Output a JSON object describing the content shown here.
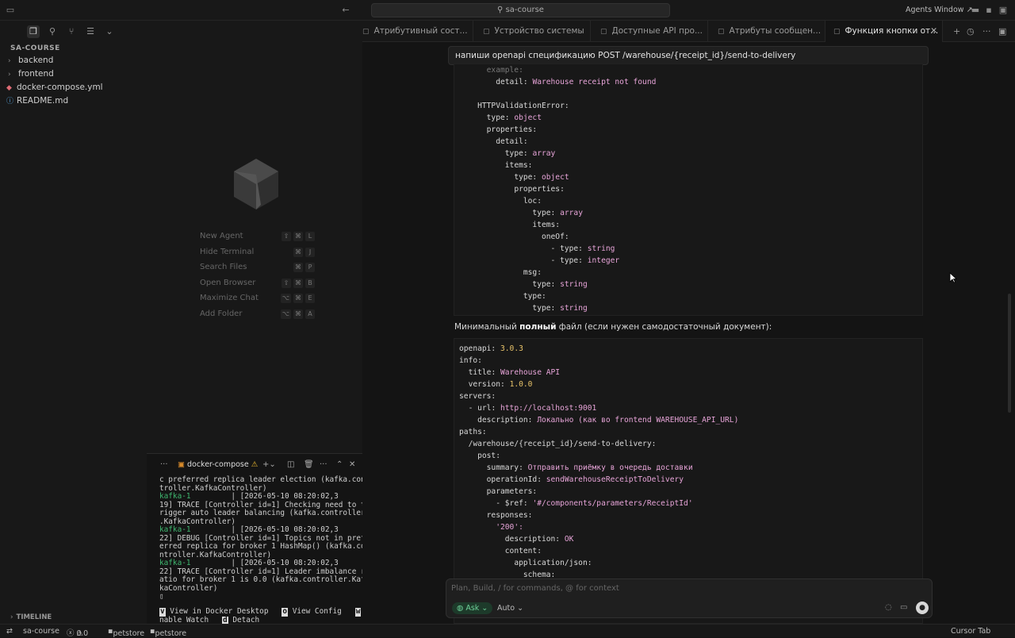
{
  "window": {
    "search_text": "sa-course",
    "agents_window": "Agents Window ↗"
  },
  "sidebar": {
    "project": "SA-COURSE",
    "items": [
      {
        "label": "backend",
        "kind": "folder"
      },
      {
        "label": "frontend",
        "kind": "folder"
      },
      {
        "label": "docker-compose.yml",
        "kind": "docker"
      },
      {
        "label": "README.md",
        "kind": "info"
      }
    ],
    "timeline": "TIMELINE"
  },
  "center": {
    "shortcuts": [
      {
        "label": "New Agent",
        "keys": [
          "⇧",
          "⌘",
          "L"
        ]
      },
      {
        "label": "Hide Terminal",
        "keys": [
          "⌘",
          "J"
        ]
      },
      {
        "label": "Search Files",
        "keys": [
          "⌘",
          "P"
        ]
      },
      {
        "label": "Open Browser",
        "keys": [
          "⇧",
          "⌘",
          "B"
        ]
      },
      {
        "label": "Maximize Chat",
        "keys": [
          "⌥",
          "⌘",
          "E"
        ]
      },
      {
        "label": "Add Folder",
        "keys": [
          "⌥",
          "⌘",
          "A"
        ]
      }
    ]
  },
  "terminal": {
    "tab_label": "docker-compose",
    "lines": [
      {
        "p": "",
        "t": "c preferred replica leader election (kafka.con"
      },
      {
        "p": "",
        "t": "troller.KafkaController)"
      },
      {
        "p": "kafka-1",
        "t": "         | [2026-05-10 08:20:02,3"
      },
      {
        "p": "",
        "t": "19] TRACE [Controller id=1] Checking need to t"
      },
      {
        "p": "",
        "t": "rigger auto leader balancing (kafka.controller"
      },
      {
        "p": "",
        "t": ".KafkaController)"
      },
      {
        "p": "kafka-1",
        "t": "         | [2026-05-10 08:20:02,3"
      },
      {
        "p": "",
        "t": "22] DEBUG [Controller id=1] Topics not in pref"
      },
      {
        "p": "",
        "t": "erred replica for broker 1 HashMap() (kafka.co"
      },
      {
        "p": "",
        "t": "ntroller.KafkaController)"
      },
      {
        "p": "kafka-1",
        "t": "         | [2026-05-10 08:20:02,3"
      },
      {
        "p": "",
        "t": "22] TRACE [Controller id=1] Leader imbalance r"
      },
      {
        "p": "",
        "t": "atio for broker 1 is 0.0 (kafka.controller.Kaf"
      },
      {
        "p": "",
        "t": "kaController)"
      },
      {
        "p": "",
        "t": "▯"
      }
    ],
    "footer": {
      "k1": "v",
      "a1": " View in Docker Desktop   ",
      "k2": "o",
      "a2": " View Config   ",
      "k3": "w",
      "a3": " E",
      "l2a": "nable Watch   ",
      "k4": "d",
      "a4": " Detach"
    }
  },
  "tabs": [
    {
      "label": "Атрибутивный сост..."
    },
    {
      "label": "Устройство системы"
    },
    {
      "label": "Доступные API про..."
    },
    {
      "label": "Атрибуты сообщен..."
    },
    {
      "label": "Функция кнопки от..."
    }
  ],
  "chat": {
    "prompt": "напиши openapi спецификацию POST /warehouse/{receipt_id}/send-to-delivery",
    "block1": [
      {
        "i": 3,
        "k": "example:",
        "v": "",
        "dim": true
      },
      {
        "i": 4,
        "k": "detail:",
        "v": "Warehouse receipt not found"
      },
      {
        "i": 0,
        "k": "",
        "v": ""
      },
      {
        "i": 2,
        "k": "HTTPValidationError:",
        "v": ""
      },
      {
        "i": 3,
        "k": "type:",
        "v": "object"
      },
      {
        "i": 3,
        "k": "properties:",
        "v": ""
      },
      {
        "i": 4,
        "k": "detail:",
        "v": ""
      },
      {
        "i": 5,
        "k": "type:",
        "v": "array"
      },
      {
        "i": 5,
        "k": "items:",
        "v": ""
      },
      {
        "i": 6,
        "k": "type:",
        "v": "object"
      },
      {
        "i": 6,
        "k": "properties:",
        "v": ""
      },
      {
        "i": 7,
        "k": "loc:",
        "v": ""
      },
      {
        "i": 8,
        "k": "type:",
        "v": "array"
      },
      {
        "i": 8,
        "k": "items:",
        "v": ""
      },
      {
        "i": 9,
        "k": "oneOf:",
        "v": ""
      },
      {
        "i": 10,
        "k": "- type:",
        "v": "string"
      },
      {
        "i": 10,
        "k": "- type:",
        "v": "integer"
      },
      {
        "i": 7,
        "k": "msg:",
        "v": ""
      },
      {
        "i": 8,
        "k": "type:",
        "v": "string"
      },
      {
        "i": 7,
        "k": "type:",
        "v": ""
      },
      {
        "i": 8,
        "k": "type:",
        "v": "string"
      }
    ],
    "mid_pre": "Минимальный ",
    "mid_bold": "полный",
    "mid_post": " файл (если нужен самодостаточный документ):",
    "block2": [
      {
        "i": 0,
        "k": "openapi:",
        "v": "3.0.3",
        "c": "n"
      },
      {
        "i": 0,
        "k": "info:",
        "v": ""
      },
      {
        "i": 1,
        "k": "title:",
        "v": "Warehouse API"
      },
      {
        "i": 1,
        "k": "version:",
        "v": "1.0.0",
        "c": "n"
      },
      {
        "i": 0,
        "k": "servers:",
        "v": ""
      },
      {
        "i": 1,
        "k": "- url:",
        "v": "http://localhost:9001"
      },
      {
        "i": 2,
        "k": "description:",
        "v": "Локально (как во frontend WAREHOUSE_API_URL)"
      },
      {
        "i": 0,
        "k": "paths:",
        "v": ""
      },
      {
        "i": 1,
        "k": "/warehouse/{receipt_id}/send-to-delivery:",
        "v": ""
      },
      {
        "i": 2,
        "k": "post:",
        "v": ""
      },
      {
        "i": 3,
        "k": "summary:",
        "v": "Отправить приёмку в очередь доставки"
      },
      {
        "i": 3,
        "k": "operationId:",
        "v": "sendWarehouseReceiptToDelivery"
      },
      {
        "i": 3,
        "k": "parameters:",
        "v": ""
      },
      {
        "i": 4,
        "k": "- $ref:",
        "v": "'#/components/parameters/ReceiptId'"
      },
      {
        "i": 3,
        "k": "responses:",
        "v": ""
      },
      {
        "i": 4,
        "k": "'200':",
        "v": "",
        "kc": "v"
      },
      {
        "i": 5,
        "k": "description:",
        "v": "OK"
      },
      {
        "i": 5,
        "k": "content:",
        "v": ""
      },
      {
        "i": 6,
        "k": "application/json:",
        "v": ""
      },
      {
        "i": 7,
        "k": "schema:",
        "v": ""
      }
    ]
  },
  "composer": {
    "placeholder": "Plan, Build, / for commands, @ for context",
    "mode": "Ask",
    "model": "Auto"
  },
  "status": {
    "branch": "sa-course",
    "problems": "0",
    "warnings": "0",
    "env1": "petstore",
    "env2": "petstore",
    "right": "Cursor Tab"
  }
}
